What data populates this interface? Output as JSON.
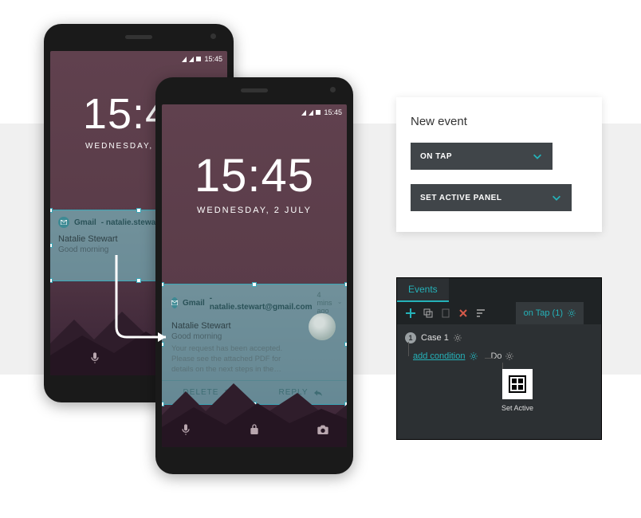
{
  "phone1": {
    "status_time": "15:45",
    "clock_time": "15:45",
    "clock_date": "WEDNESDAY, 2 JULY",
    "notif": {
      "app": "Gmail",
      "from": "natalie.stewart@gmail.com",
      "sender": "Natalie Stewart",
      "subject": "Good morning"
    }
  },
  "phone2": {
    "status_time": "15:45",
    "clock_time": "15:45",
    "clock_date": "WEDNESDAY, 2 JULY",
    "notif": {
      "app": "Gmail",
      "from": "natalie.stewart@gmail.com",
      "meta": "4 mins ago",
      "sender": "Natalie Stewart",
      "subject": "Good morning",
      "body": "Your request has been accepted. Please see the attached PDF for details on the next steps in the…",
      "delete": "DELETE",
      "reply": "REPLY"
    }
  },
  "new_event": {
    "title": "New event",
    "trigger": "ON TAP",
    "action": "SET ACTIVE PANEL"
  },
  "events": {
    "tab": "Events",
    "subtab": "on Tap (1)",
    "case_label": "Case 1",
    "add_condition": "add condition",
    "do": "Do",
    "action": "Set Active"
  }
}
